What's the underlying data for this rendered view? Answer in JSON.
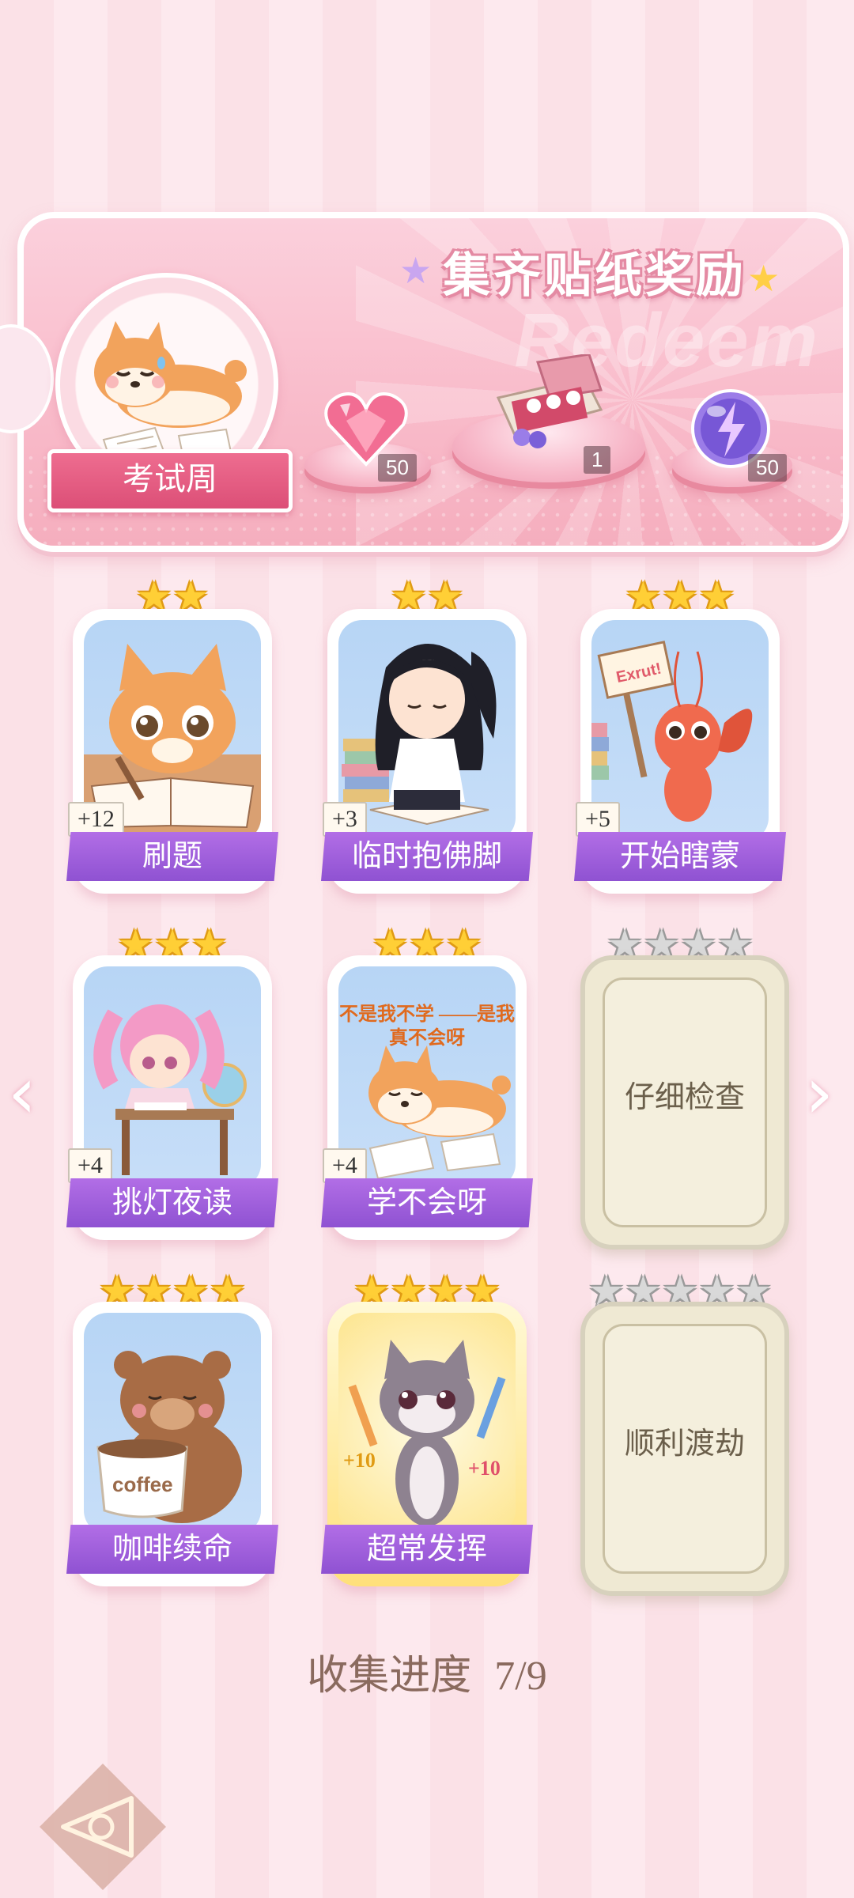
{
  "banner": {
    "title": "集齐贴纸奖励",
    "watermark": "Redeem",
    "level_label": "考试周",
    "rewards": [
      {
        "icon": "heart-gem-icon",
        "count": "50"
      },
      {
        "icon": "gift-box-icon",
        "count": "1"
      },
      {
        "icon": "lightning-orb-icon",
        "count": "50"
      }
    ]
  },
  "stickers": [
    {
      "name": "刷题",
      "bonus": "+12",
      "stars": 2,
      "collected": true,
      "icon": "cat-writing-icon"
    },
    {
      "name": "临时抱佛脚",
      "bonus": "+3",
      "stars": 2,
      "collected": true,
      "icon": "girl-reading-icon"
    },
    {
      "name": "开始瞎蒙",
      "bonus": "+5",
      "stars": 3,
      "collected": true,
      "icon": "lobster-sign-icon",
      "sign_text": "Exrut!"
    },
    {
      "name": "挑灯夜读",
      "bonus": "+4",
      "stars": 3,
      "collected": true,
      "icon": "girl-desk-icon"
    },
    {
      "name": "学不会呀",
      "bonus": "+4",
      "stars": 3,
      "collected": true,
      "icon": "shiba-lying-icon",
      "caption": "不是我不学 ——是我真不会呀"
    },
    {
      "name": "仔细检查",
      "stars": 4,
      "collected": false
    },
    {
      "name": "咖啡续命",
      "stars": 4,
      "collected": true,
      "icon": "bear-coffee-icon",
      "cup_text": "coffee"
    },
    {
      "name": "超常发挥",
      "stars": 4,
      "collected": true,
      "icon": "cat-pencils-icon",
      "left_text": "+10",
      "right_text": "+10"
    },
    {
      "name": "顺利渡劫",
      "stars": 5,
      "collected": false
    }
  ],
  "progress": {
    "label": "收集进度",
    "value": "7/9"
  }
}
